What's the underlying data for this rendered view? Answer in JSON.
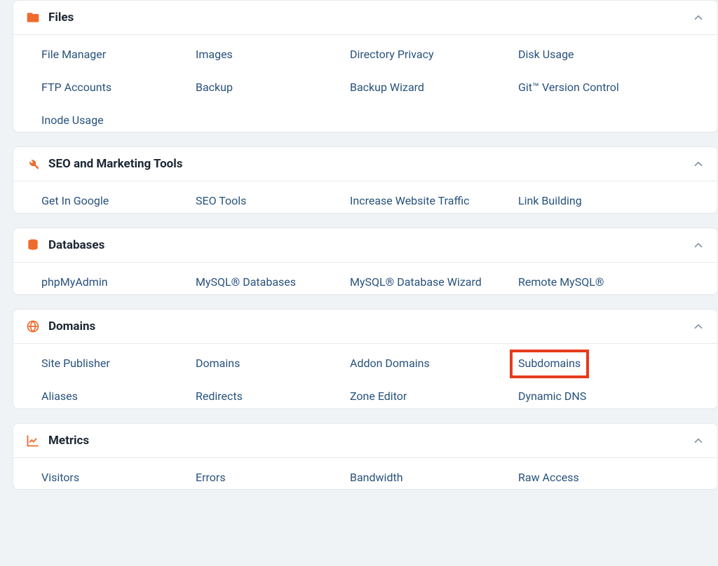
{
  "sections": [
    {
      "key": "files",
      "title": "Files",
      "icon": "folder-icon",
      "items": [
        {
          "label": "File Manager"
        },
        {
          "label": "Images"
        },
        {
          "label": "Directory Privacy"
        },
        {
          "label": "Disk Usage"
        },
        {
          "label": "FTP Accounts"
        },
        {
          "label": "Backup"
        },
        {
          "label": "Backup Wizard"
        },
        {
          "label": "Git™ Version Control"
        },
        {
          "label": "Inode Usage"
        }
      ]
    },
    {
      "key": "seo",
      "title": "SEO and Marketing Tools",
      "icon": "tools-icon",
      "items": [
        {
          "label": "Get In Google"
        },
        {
          "label": "SEO Tools"
        },
        {
          "label": "Increase Website Traffic"
        },
        {
          "label": "Link Building"
        }
      ]
    },
    {
      "key": "databases",
      "title": "Databases",
      "icon": "database-icon",
      "items": [
        {
          "label": "phpMyAdmin"
        },
        {
          "label": "MySQL® Databases"
        },
        {
          "label": "MySQL® Database Wizard"
        },
        {
          "label": "Remote MySQL®"
        }
      ]
    },
    {
      "key": "domains",
      "title": "Domains",
      "icon": "globe-icon",
      "items": [
        {
          "label": "Site Publisher"
        },
        {
          "label": "Domains"
        },
        {
          "label": "Addon Domains"
        },
        {
          "label": "Subdomains",
          "highlight": true
        },
        {
          "label": "Aliases"
        },
        {
          "label": "Redirects"
        },
        {
          "label": "Zone Editor"
        },
        {
          "label": "Dynamic DNS"
        }
      ]
    },
    {
      "key": "metrics",
      "title": "Metrics",
      "icon": "chart-icon",
      "items": [
        {
          "label": "Visitors"
        },
        {
          "label": "Errors"
        },
        {
          "label": "Bandwidth"
        },
        {
          "label": "Raw Access"
        }
      ]
    }
  ]
}
